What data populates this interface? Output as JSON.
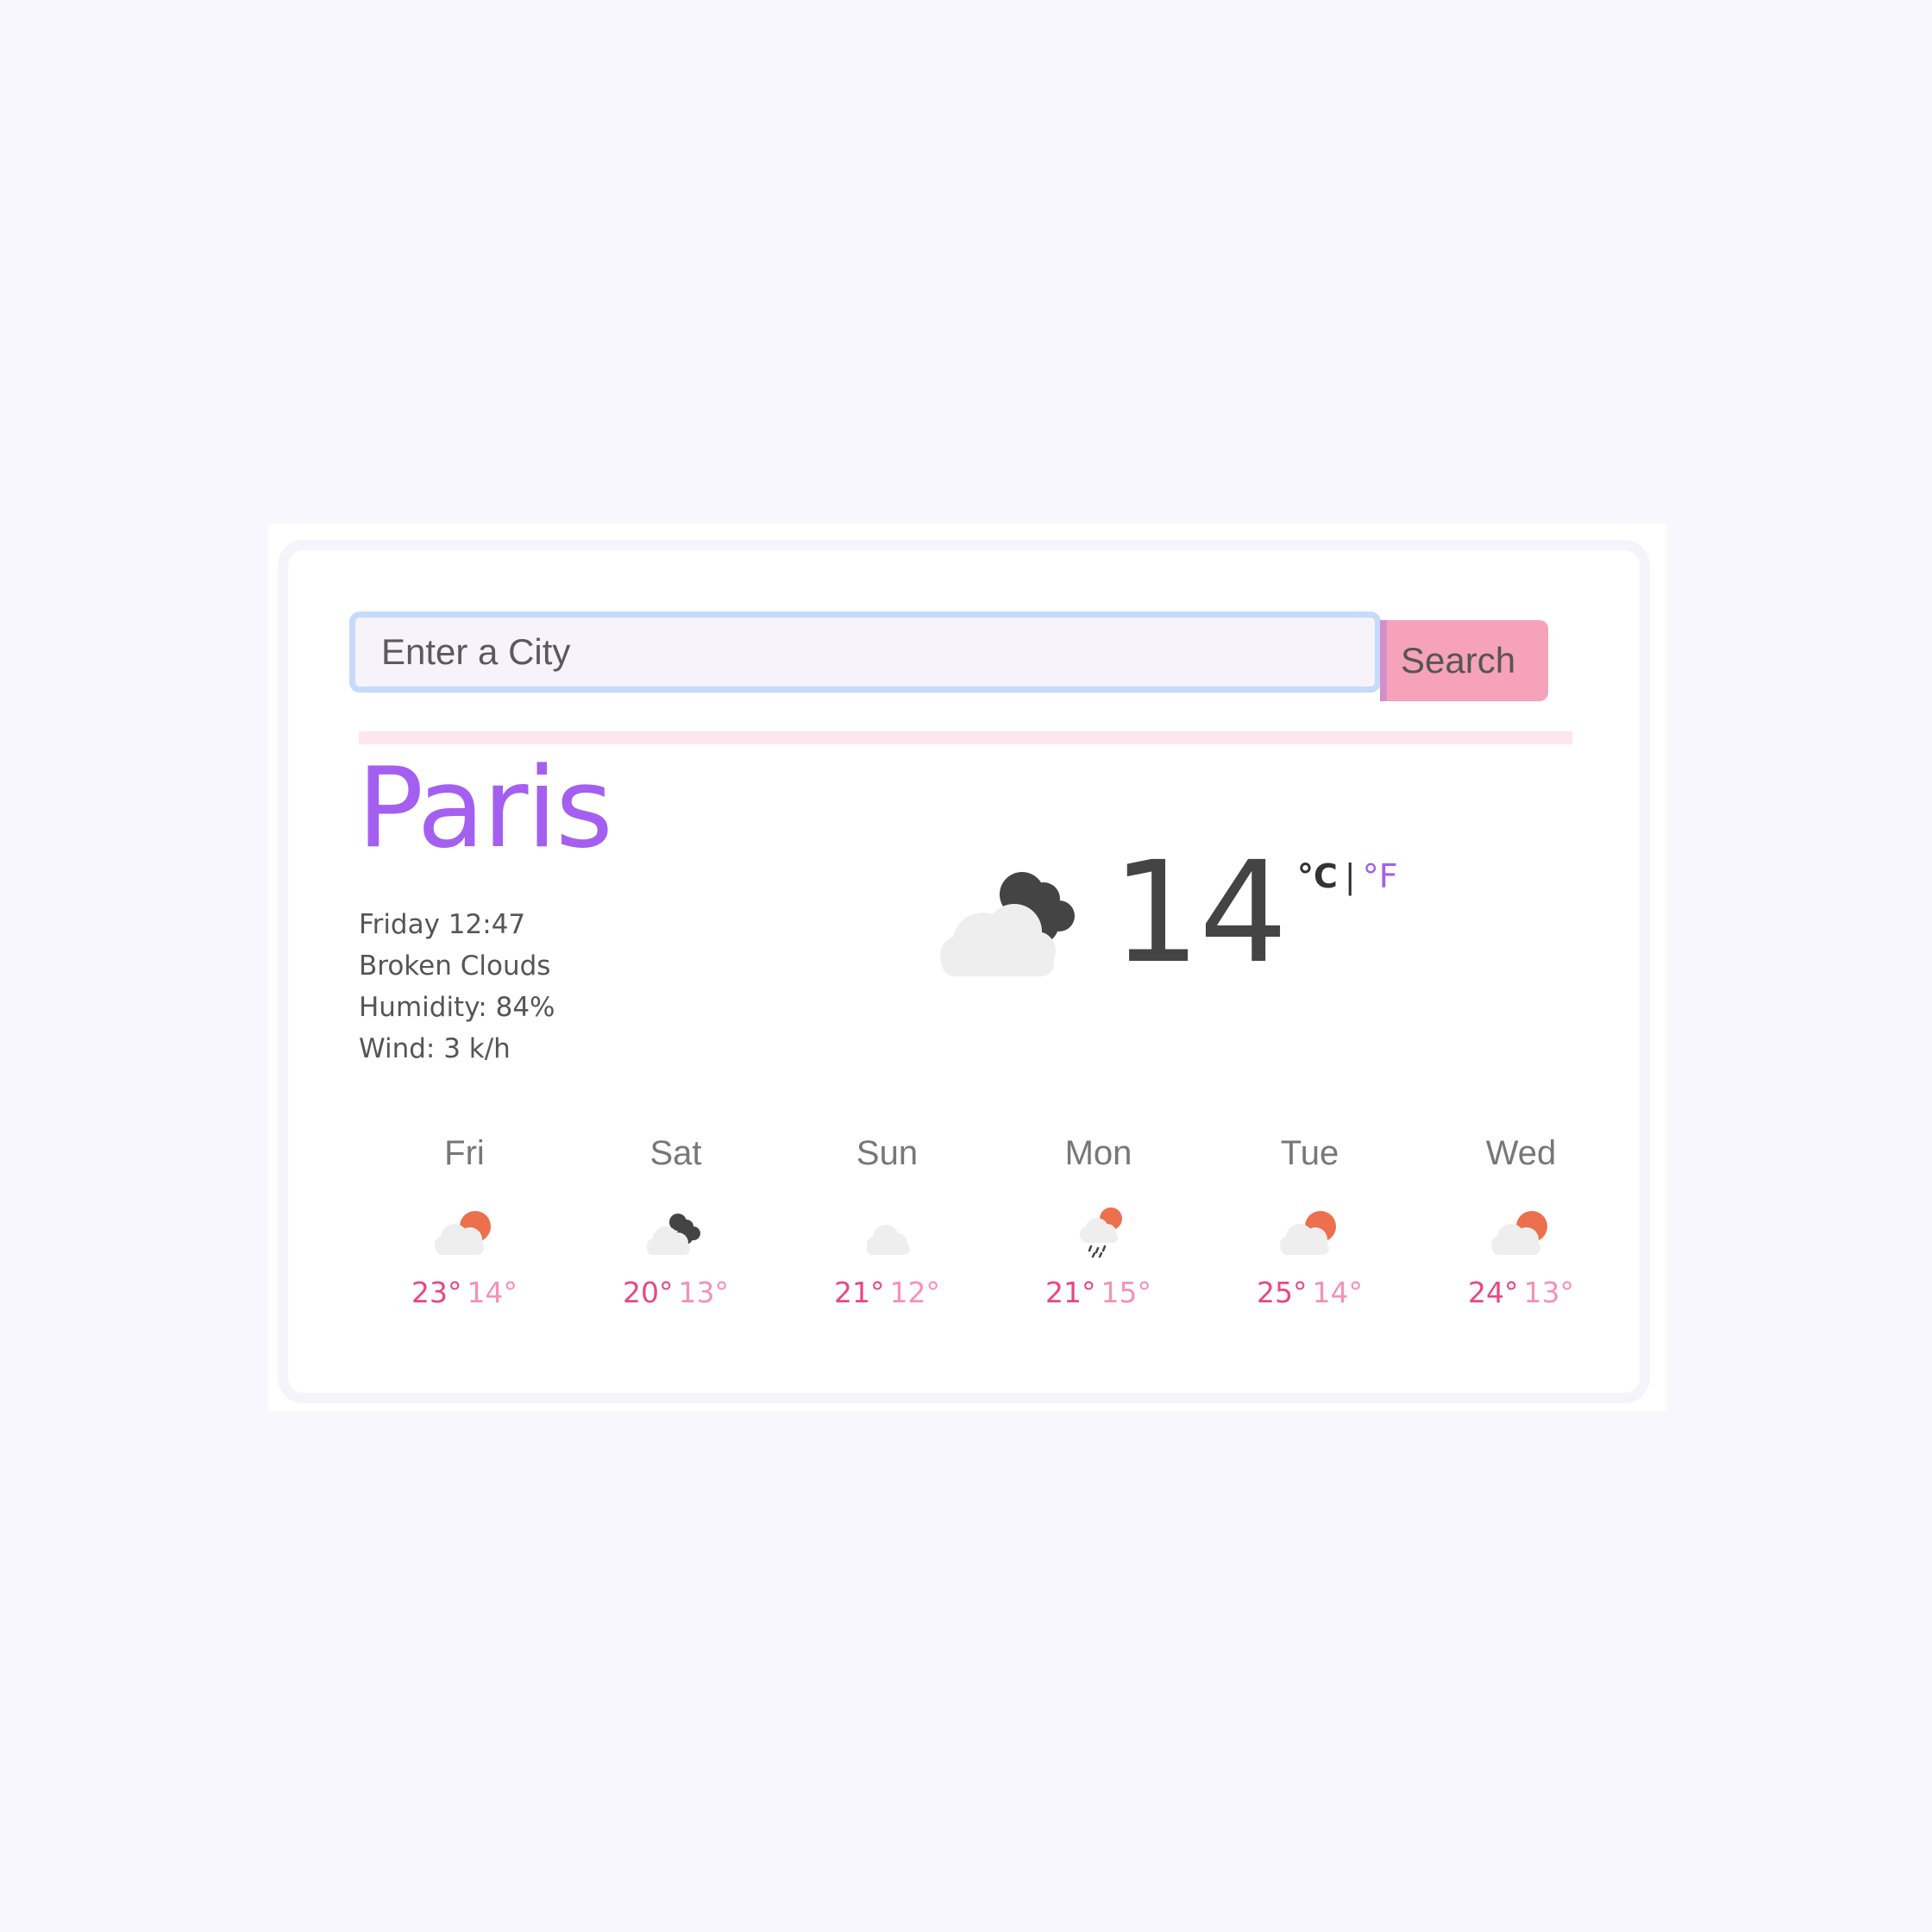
{
  "search": {
    "placeholder": "Enter a City",
    "button_label": "Search"
  },
  "current": {
    "city": "Paris",
    "datetime": "Friday 12:47",
    "description": "Broken Clouds",
    "humidity": "Humidity: 84%",
    "wind": "Wind: 3 k/h",
    "temperature": "14",
    "icon": "broken-clouds-icon",
    "unit_celsius": "°C",
    "unit_separator": "|",
    "unit_fahrenheit": "°F"
  },
  "forecast": [
    {
      "day": "Fri",
      "icon": "partly-cloudy-icon",
      "max": "23°",
      "min": "14°"
    },
    {
      "day": "Sat",
      "icon": "broken-clouds-icon",
      "max": "20°",
      "min": "13°"
    },
    {
      "day": "Sun",
      "icon": "cloud-icon",
      "max": "21°",
      "min": "12°"
    },
    {
      "day": "Mon",
      "icon": "rain-icon",
      "max": "21°",
      "min": "15°"
    },
    {
      "day": "Tue",
      "icon": "partly-cloudy-icon",
      "max": "25°",
      "min": "14°"
    },
    {
      "day": "Wed",
      "icon": "partly-cloudy-icon",
      "max": "24°",
      "min": "13°"
    }
  ],
  "colors": {
    "accent_purple": "#a45ff0",
    "search_button_bg": "#f6a2ba",
    "temp_max": "#e9487f",
    "temp_min": "#f592b4",
    "sun_orange": "#ec6f4e",
    "dark_cloud": "#444444",
    "light_cloud": "#eeeeee"
  }
}
